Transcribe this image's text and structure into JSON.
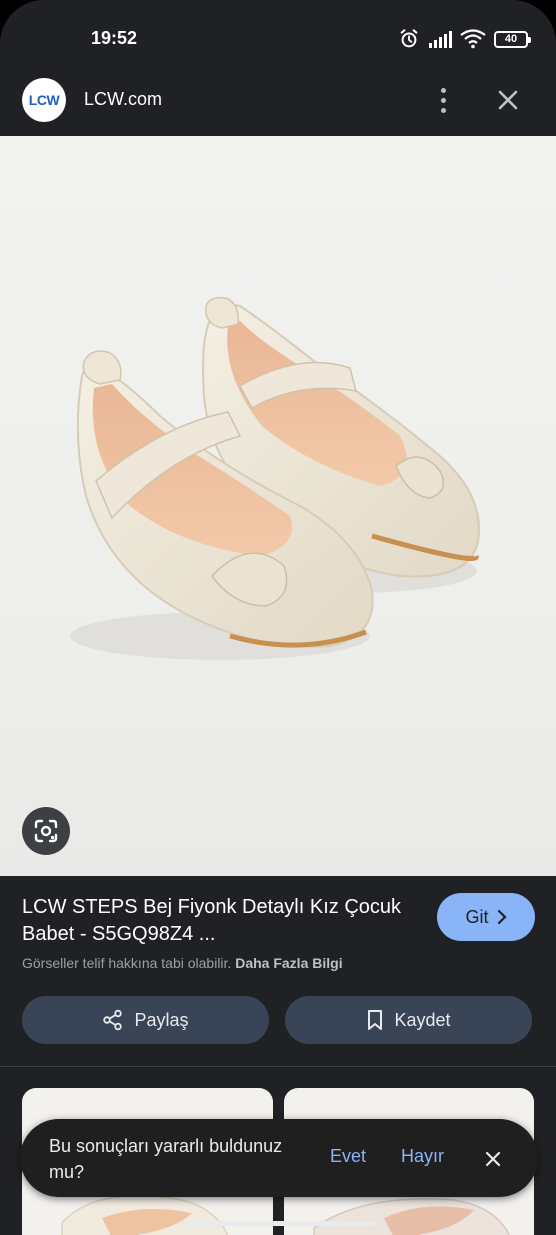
{
  "status_bar": {
    "time": "19:52",
    "battery": "40",
    "icons": [
      "alarm-icon",
      "signal-icon",
      "wifi-icon",
      "battery-icon"
    ]
  },
  "header": {
    "logo_text": "LCW",
    "site_name": "LCW.com",
    "icons": [
      "more-vert-icon",
      "close-icon"
    ]
  },
  "image": {
    "alt": "",
    "lens_icon": "google-lens-icon"
  },
  "product": {
    "title": "LCW STEPS Bej Fiyonk Detaylı Kız Çocuk Babet - S5GQ98Z4 ...",
    "go_label": "Git",
    "copyright_text": "Görseller telif hakkına tabi olabilir.",
    "more_info_label": "Daha Fazla Bilgi",
    "share_label": "Paylaş",
    "save_label": "Kaydet"
  },
  "feedback": {
    "question": "Bu sonuçları yararlı buldunuz mu?",
    "yes_label": "Evet",
    "no_label": "Hayır"
  },
  "colors": {
    "background": "#202124",
    "accent": "#8ab4f8",
    "button_bg": "#394457",
    "brand_blue": "#1f5fbf"
  }
}
